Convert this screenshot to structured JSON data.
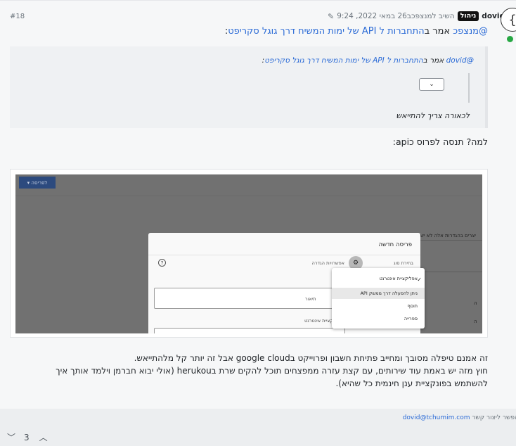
{
  "post": {
    "index": "#18",
    "username": "dovid",
    "badge": "ניהול",
    "replied": "השיב ל",
    "replied_to": "מנצפכ",
    "in": " ב",
    "timestamp": "26 במאי 2022, 9:24",
    "edit_icon": "edit-icon"
  },
  "mention": {
    "user": "@מנצפכ",
    "said": " אמר ב",
    "link": "התחברות ל API של ימות המשיח דרך גוגל סקריפט",
    "colon": ":"
  },
  "quote": {
    "user": "@dovid",
    "said": " אמר ב",
    "link": "התחברות ל API של ימות המשיח דרך גוגל סקריפט",
    "colon": ":",
    "select_glyph": "⌄",
    "end": "לכאורה צריך להתייאש"
  },
  "why": "למה? תנסה לפרוס כapi:",
  "screenshot": {
    "button": "לפריסה",
    "bg_text": "יצרים בהגדרות אלה לא ישפי",
    "dialog_title": "פריסה חדשה",
    "label_type": "בחירת סוג",
    "label_settings": "אפשרויות הגדרה",
    "input_label": "תיאור",
    "label_app": "אפליקציית אינטרנט",
    "dropdown": [
      "אפליקציית אינטרנט",
      "ניתן להפעלה דרך ממשק API",
      "תוסף",
      "ספרייה"
    ],
    "side1": "ה",
    "side2": "ה"
  },
  "body": {
    "line1": "זה אמנם טיפלה מסובך ומחייב פתיחת חשבון ופרוייקט בgoogle cloud אבל זה יותר קל מלהתייאש.",
    "line2": "חוץ מזה יש באמת עוד שירותים, עם קצת עזרה ממפצחים תוכל להקים שרת בherukou (אולי יבוא חברמן וילמד אותך איך",
    "line3": "להשתמש בפונקציית ענן חינמית כל שהיא)."
  },
  "footer": {
    "signature_prefix": "אפשר ליצור קשר ",
    "signature_email": "dovid@tchumim.com",
    "vote_count": "3"
  }
}
